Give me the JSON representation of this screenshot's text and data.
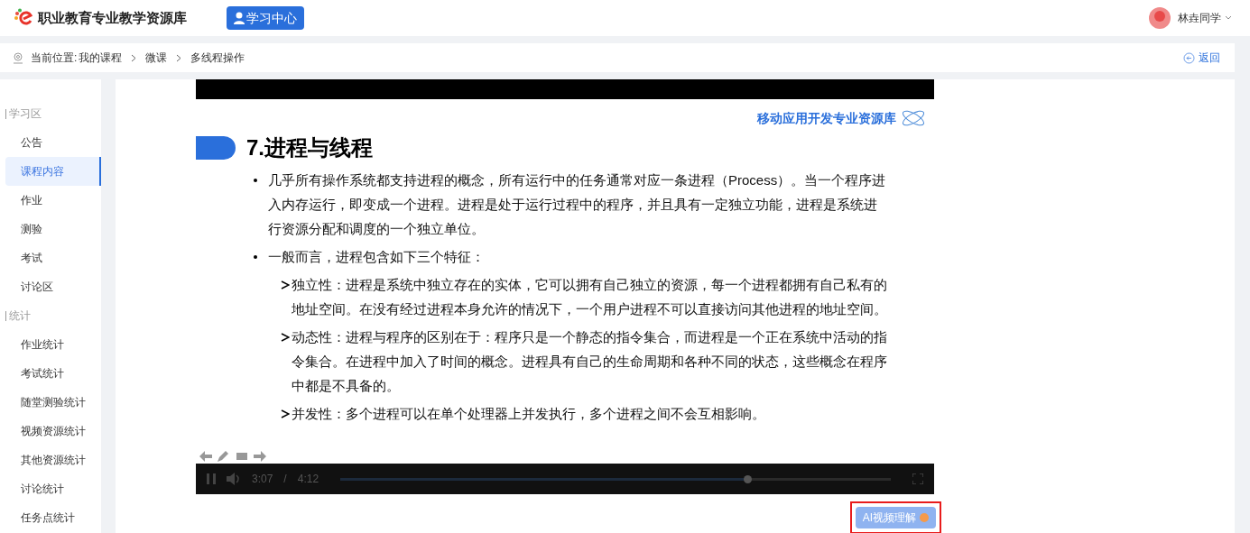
{
  "header": {
    "site_title": "职业教育专业教学资源库",
    "center_button": "学习中心",
    "user_name": "林垚同学"
  },
  "breadcrumb": {
    "label": "当前位置:",
    "items": [
      "我的课程",
      "微课",
      "多线程操作"
    ],
    "back": "返回"
  },
  "sidebar": {
    "sections": [
      {
        "title": "学习区",
        "items": [
          {
            "label": "公告",
            "selected": false
          },
          {
            "label": "课程内容",
            "selected": true
          },
          {
            "label": "作业",
            "selected": false
          },
          {
            "label": "测验",
            "selected": false
          },
          {
            "label": "考试",
            "selected": false
          },
          {
            "label": "讨论区",
            "selected": false
          }
        ]
      },
      {
        "title": "统计",
        "items": [
          {
            "label": "作业统计",
            "selected": false
          },
          {
            "label": "考试统计",
            "selected": false
          },
          {
            "label": "随堂测验统计",
            "selected": false
          },
          {
            "label": "视频资源统计",
            "selected": false
          },
          {
            "label": "其他资源统计",
            "selected": false
          },
          {
            "label": "讨论统计",
            "selected": false
          },
          {
            "label": "任务点统计",
            "selected": false
          }
        ]
      }
    ]
  },
  "slide": {
    "brand": "移动应用开发专业资源库",
    "heading": "7.进程与线程",
    "bullets": [
      {
        "text": "几乎所有操作系统都支持进程的概念，所有运行中的任务通常对应一条进程（Process）。当一个程序进入内存运行，即变成一个进程。进程是处于运行过程中的程序，并且具有一定独立功能，进程是系统进行资源分配和调度的一个独立单位。"
      },
      {
        "text": "一般而言，进程包含如下三个特征：",
        "children": [
          {
            "text": "独立性：进程是系统中独立存在的实体，它可以拥有自己独立的资源，每一个进程都拥有自己私有的地址空间。在没有经过进程本身允许的情况下，一个用户进程不可以直接访问其他进程的地址空间。"
          },
          {
            "text": "动态性：进程与程序的区别在于：程序只是一个静态的指令集合，而进程是一个正在系统中活动的指令集合。在进程中加入了时间的概念。进程具有自己的生命周期和各种不同的状态，这些概念在程序中都是不具备的。"
          },
          {
            "text": "并发性：多个进程可以在单个处理器上并发执行，多个进程之间不会互相影响。"
          }
        ]
      }
    ]
  },
  "player": {
    "current_time": "3:07",
    "separator": "/",
    "duration": "4:12",
    "progress": {
      "level": 0.74
    }
  },
  "ai_button": {
    "label": "AI视频理解"
  }
}
